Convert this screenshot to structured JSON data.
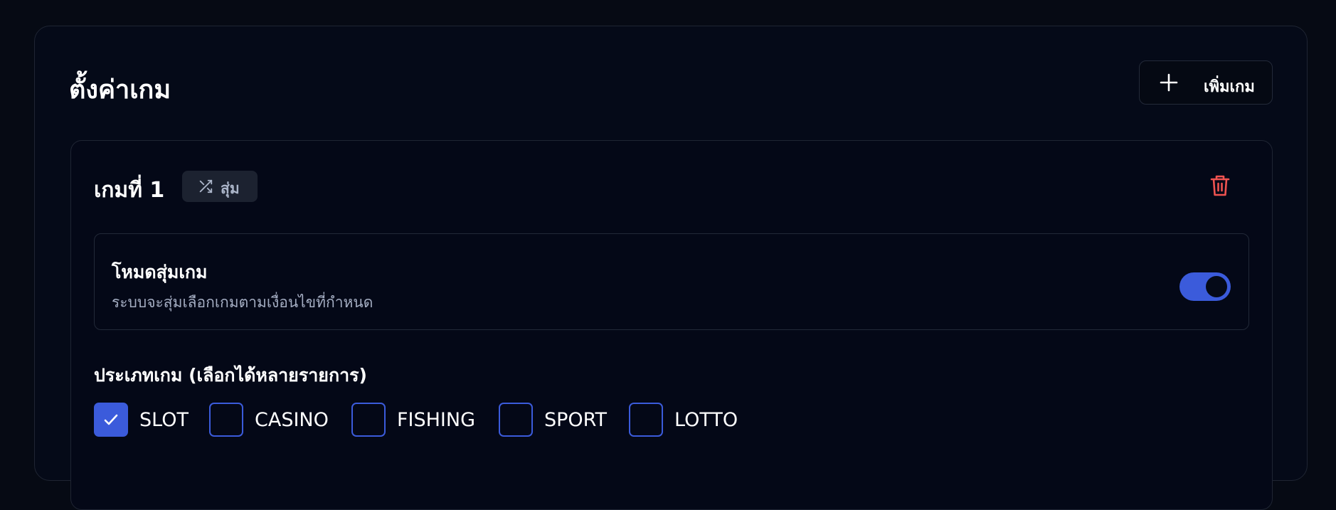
{
  "page": {
    "title": "ตั้งค่าเกม",
    "add_button_label": "เพิ่มเกม"
  },
  "game": {
    "title": "เกมที่ 1",
    "badge_label": "สุ่ม",
    "random_mode": {
      "title": "โหมดสุ่มเกม",
      "description": "ระบบจะสุ่มเลือกเกมตามเงื่อนไขที่กำหนด",
      "enabled": true
    },
    "types_label": "ประเภทเกม (เลือกได้หลายรายการ)",
    "types": [
      {
        "label": "SLOT",
        "checked": true
      },
      {
        "label": "CASINO",
        "checked": false
      },
      {
        "label": "FISHING",
        "checked": false
      },
      {
        "label": "SPORT",
        "checked": false
      },
      {
        "label": "LOTTO",
        "checked": false
      }
    ]
  },
  "colors": {
    "background": "#060a14",
    "accent": "#3b5bdb",
    "danger": "#ef5350",
    "muted_text": "#a4adc2"
  },
  "icons": {
    "add": "plus-icon",
    "badge": "shuffle-icon",
    "delete": "trash-icon",
    "check": "checkmark-icon"
  }
}
